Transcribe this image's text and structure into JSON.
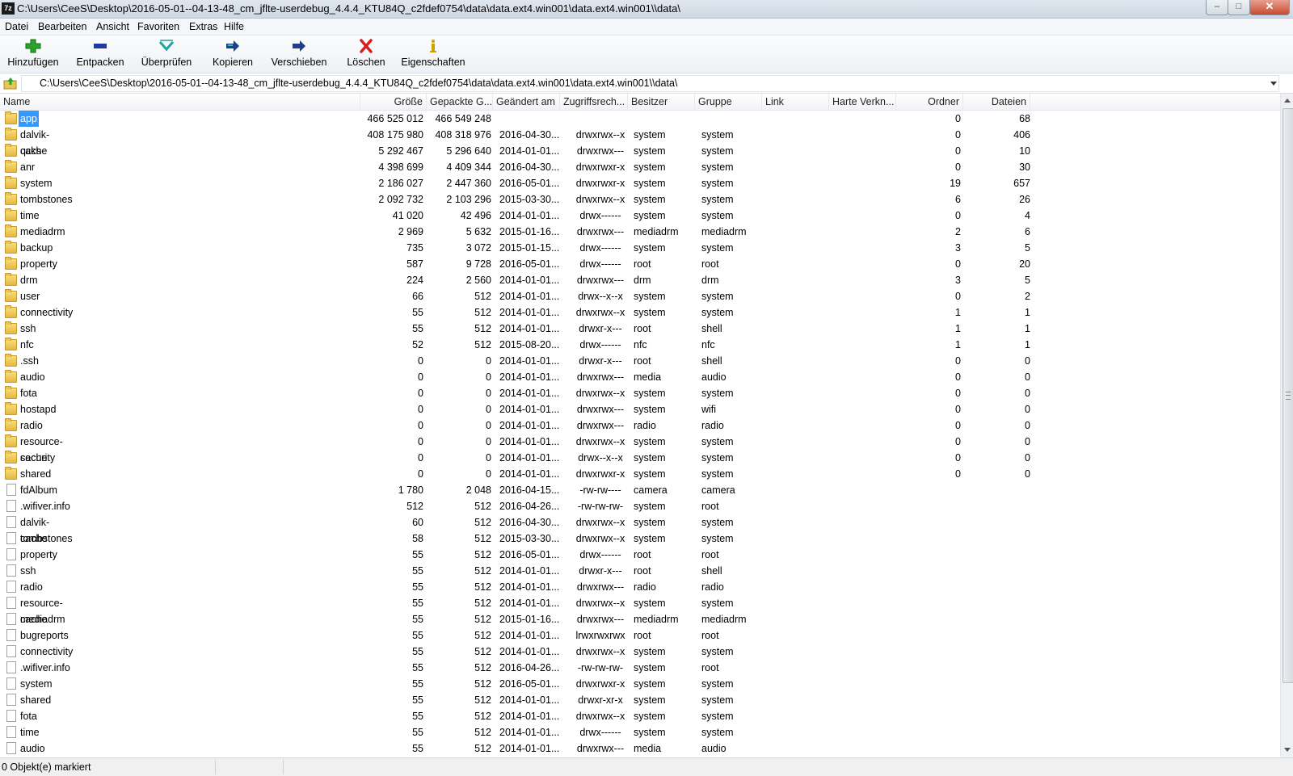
{
  "window": {
    "title": "C:\\Users\\CeeS\\Desktop\\2016-05-01--04-13-48_cm_jflte-userdebug_4.4.4_KTU84Q_c2fdef0754\\data\\data.ext4.win001\\data.ext4.win001\\\\data\\",
    "app_icon_text": "7z",
    "minimize": "–",
    "maximize": "□",
    "close": "✕"
  },
  "menu": [
    "Datei",
    "Bearbeiten",
    "Ansicht",
    "Favoriten",
    "Extras",
    "Hilfe"
  ],
  "toolbar": [
    {
      "label": "Hinzufügen",
      "icon": "add-icon",
      "color": "#2aa32a"
    },
    {
      "label": "Entpacken",
      "icon": "extract-icon",
      "color": "#1e3a9a"
    },
    {
      "label": "Überprüfen",
      "icon": "test-icon",
      "color": "#21a3a0"
    },
    {
      "label": "Kopieren",
      "icon": "copy-icon",
      "color": "#1d3f8a"
    },
    {
      "label": "Verschieben",
      "icon": "move-icon",
      "color": "#1d3f8a"
    },
    {
      "label": "Löschen",
      "icon": "delete-icon",
      "color": "#d42020"
    },
    {
      "label": "Eigenschaften",
      "icon": "info-icon",
      "color": "#c9a400"
    }
  ],
  "address": {
    "path": "C:\\Users\\CeeS\\Desktop\\2016-05-01--04-13-48_cm_jflte-userdebug_4.4.4_KTU84Q_c2fdef0754\\data\\data.ext4.win001\\data.ext4.win001\\\\data\\"
  },
  "columns": [
    "Name",
    "Größe",
    "Gepackte G...",
    "Geändert am",
    "Zugriffsrech...",
    "Besitzer",
    "Gruppe",
    "Link",
    "Harte Verkn...",
    "Ordner",
    "Dateien"
  ],
  "rows": [
    {
      "type": "folder",
      "name": "app",
      "size": "466 525 012",
      "packed": "466 549 248",
      "modified": "",
      "attr": "",
      "owner": "",
      "group": "",
      "folders": "0",
      "files": "68",
      "selected": true
    },
    {
      "type": "folder",
      "name": "dalvik-cache",
      "size": "408 175 980",
      "packed": "408 318 976",
      "modified": "2016-04-30...",
      "attr": "drwxrwx--x",
      "owner": "system",
      "group": "system",
      "folders": "0",
      "files": "406"
    },
    {
      "type": "folder",
      "name": "qcks",
      "size": "5 292 467",
      "packed": "5 296 640",
      "modified": "2014-01-01...",
      "attr": "drwxrwx---",
      "owner": "system",
      "group": "system",
      "folders": "0",
      "files": "10"
    },
    {
      "type": "folder",
      "name": "anr",
      "size": "4 398 699",
      "packed": "4 409 344",
      "modified": "2016-04-30...",
      "attr": "drwxrwxr-x",
      "owner": "system",
      "group": "system",
      "folders": "0",
      "files": "30"
    },
    {
      "type": "folder",
      "name": "system",
      "size": "2 186 027",
      "packed": "2 447 360",
      "modified": "2016-05-01...",
      "attr": "drwxrwxr-x",
      "owner": "system",
      "group": "system",
      "folders": "19",
      "files": "657"
    },
    {
      "type": "folder",
      "name": "tombstones",
      "size": "2 092 732",
      "packed": "2 103 296",
      "modified": "2015-03-30...",
      "attr": "drwxrwx--x",
      "owner": "system",
      "group": "system",
      "folders": "6",
      "files": "26"
    },
    {
      "type": "folder",
      "name": "time",
      "size": "41 020",
      "packed": "42 496",
      "modified": "2014-01-01...",
      "attr": "drwx------",
      "owner": "system",
      "group": "system",
      "folders": "0",
      "files": "4"
    },
    {
      "type": "folder",
      "name": "mediadrm",
      "size": "2 969",
      "packed": "5 632",
      "modified": "2015-01-16...",
      "attr": "drwxrwx---",
      "owner": "mediadrm",
      "group": "mediadrm",
      "folders": "2",
      "files": "6"
    },
    {
      "type": "folder",
      "name": "backup",
      "size": "735",
      "packed": "3 072",
      "modified": "2015-01-15...",
      "attr": "drwx------",
      "owner": "system",
      "group": "system",
      "folders": "3",
      "files": "5"
    },
    {
      "type": "folder",
      "name": "property",
      "size": "587",
      "packed": "9 728",
      "modified": "2016-05-01...",
      "attr": "drwx------",
      "owner": "root",
      "group": "root",
      "folders": "0",
      "files": "20"
    },
    {
      "type": "folder",
      "name": "drm",
      "size": "224",
      "packed": "2 560",
      "modified": "2014-01-01...",
      "attr": "drwxrwx---",
      "owner": "drm",
      "group": "drm",
      "folders": "3",
      "files": "5"
    },
    {
      "type": "folder",
      "name": "user",
      "size": "66",
      "packed": "512",
      "modified": "2014-01-01...",
      "attr": "drwx--x--x",
      "owner": "system",
      "group": "system",
      "folders": "0",
      "files": "2"
    },
    {
      "type": "folder",
      "name": "connectivity",
      "size": "55",
      "packed": "512",
      "modified": "2014-01-01...",
      "attr": "drwxrwx--x",
      "owner": "system",
      "group": "system",
      "folders": "1",
      "files": "1"
    },
    {
      "type": "folder",
      "name": "ssh",
      "size": "55",
      "packed": "512",
      "modified": "2014-01-01...",
      "attr": "drwxr-x---",
      "owner": "root",
      "group": "shell",
      "folders": "1",
      "files": "1"
    },
    {
      "type": "folder",
      "name": "nfc",
      "size": "52",
      "packed": "512",
      "modified": "2015-08-20...",
      "attr": "drwx------",
      "owner": "nfc",
      "group": "nfc",
      "folders": "1",
      "files": "1"
    },
    {
      "type": "folder",
      "name": ".ssh",
      "size": "0",
      "packed": "0",
      "modified": "2014-01-01...",
      "attr": "drwxr-x---",
      "owner": "root",
      "group": "shell",
      "folders": "0",
      "files": "0"
    },
    {
      "type": "folder",
      "name": "audio",
      "size": "0",
      "packed": "0",
      "modified": "2014-01-01...",
      "attr": "drwxrwx---",
      "owner": "media",
      "group": "audio",
      "folders": "0",
      "files": "0"
    },
    {
      "type": "folder",
      "name": "fota",
      "size": "0",
      "packed": "0",
      "modified": "2014-01-01...",
      "attr": "drwxrwx--x",
      "owner": "system",
      "group": "system",
      "folders": "0",
      "files": "0"
    },
    {
      "type": "folder",
      "name": "hostapd",
      "size": "0",
      "packed": "0",
      "modified": "2014-01-01...",
      "attr": "drwxrwx---",
      "owner": "system",
      "group": "wifi",
      "folders": "0",
      "files": "0"
    },
    {
      "type": "folder",
      "name": "radio",
      "size": "0",
      "packed": "0",
      "modified": "2014-01-01...",
      "attr": "drwxrwx---",
      "owner": "radio",
      "group": "radio",
      "folders": "0",
      "files": "0"
    },
    {
      "type": "folder",
      "name": "resource-cache",
      "size": "0",
      "packed": "0",
      "modified": "2014-01-01...",
      "attr": "drwxrwx--x",
      "owner": "system",
      "group": "system",
      "folders": "0",
      "files": "0"
    },
    {
      "type": "folder",
      "name": "security",
      "size": "0",
      "packed": "0",
      "modified": "2014-01-01...",
      "attr": "drwx--x--x",
      "owner": "system",
      "group": "system",
      "folders": "0",
      "files": "0"
    },
    {
      "type": "folder",
      "name": "shared",
      "size": "0",
      "packed": "0",
      "modified": "2014-01-01...",
      "attr": "drwxrwxr-x",
      "owner": "system",
      "group": "system",
      "folders": "0",
      "files": "0"
    },
    {
      "type": "file",
      "name": "fdAlbum",
      "size": "1 780",
      "packed": "2 048",
      "modified": "2016-04-15...",
      "attr": "-rw-rw----",
      "owner": "camera",
      "group": "camera",
      "folders": "",
      "files": ""
    },
    {
      "type": "file",
      "name": ".wifiver.info",
      "size": "512",
      "packed": "512",
      "modified": "2016-04-26...",
      "attr": "-rw-rw-rw-",
      "owner": "system",
      "group": "root",
      "folders": "",
      "files": ""
    },
    {
      "type": "file",
      "name": "dalvik-cache",
      "size": "60",
      "packed": "512",
      "modified": "2016-04-30...",
      "attr": "drwxrwx--x",
      "owner": "system",
      "group": "system",
      "folders": "",
      "files": ""
    },
    {
      "type": "file",
      "name": "tombstones",
      "size": "58",
      "packed": "512",
      "modified": "2015-03-30...",
      "attr": "drwxrwx--x",
      "owner": "system",
      "group": "system",
      "folders": "",
      "files": ""
    },
    {
      "type": "file",
      "name": "property",
      "size": "55",
      "packed": "512",
      "modified": "2016-05-01...",
      "attr": "drwx------",
      "owner": "root",
      "group": "root",
      "folders": "",
      "files": ""
    },
    {
      "type": "file",
      "name": "ssh",
      "size": "55",
      "packed": "512",
      "modified": "2014-01-01...",
      "attr": "drwxr-x---",
      "owner": "root",
      "group": "shell",
      "folders": "",
      "files": ""
    },
    {
      "type": "file",
      "name": "radio",
      "size": "55",
      "packed": "512",
      "modified": "2014-01-01...",
      "attr": "drwxrwx---",
      "owner": "radio",
      "group": "radio",
      "folders": "",
      "files": ""
    },
    {
      "type": "file",
      "name": "resource-cache",
      "size": "55",
      "packed": "512",
      "modified": "2014-01-01...",
      "attr": "drwxrwx--x",
      "owner": "system",
      "group": "system",
      "folders": "",
      "files": ""
    },
    {
      "type": "file",
      "name": "mediadrm",
      "size": "55",
      "packed": "512",
      "modified": "2015-01-16...",
      "attr": "drwxrwx---",
      "owner": "mediadrm",
      "group": "mediadrm",
      "folders": "",
      "files": ""
    },
    {
      "type": "file",
      "name": "bugreports",
      "size": "55",
      "packed": "512",
      "modified": "2014-01-01...",
      "attr": "lrwxrwxrwx",
      "owner": "root",
      "group": "root",
      "folders": "",
      "files": ""
    },
    {
      "type": "file",
      "name": "connectivity",
      "size": "55",
      "packed": "512",
      "modified": "2014-01-01...",
      "attr": "drwxrwx--x",
      "owner": "system",
      "group": "system",
      "folders": "",
      "files": ""
    },
    {
      "type": "file",
      "name": ".wifiver.info",
      "size": "55",
      "packed": "512",
      "modified": "2016-04-26...",
      "attr": "-rw-rw-rw-",
      "owner": "system",
      "group": "root",
      "folders": "",
      "files": ""
    },
    {
      "type": "file",
      "name": "system",
      "size": "55",
      "packed": "512",
      "modified": "2016-05-01...",
      "attr": "drwxrwxr-x",
      "owner": "system",
      "group": "system",
      "folders": "",
      "files": ""
    },
    {
      "type": "file",
      "name": "shared",
      "size": "55",
      "packed": "512",
      "modified": "2014-01-01...",
      "attr": "drwxr-xr-x",
      "owner": "system",
      "group": "system",
      "folders": "",
      "files": ""
    },
    {
      "type": "file",
      "name": "fota",
      "size": "55",
      "packed": "512",
      "modified": "2014-01-01...",
      "attr": "drwxrwx--x",
      "owner": "system",
      "group": "system",
      "folders": "",
      "files": ""
    },
    {
      "type": "file",
      "name": "time",
      "size": "55",
      "packed": "512",
      "modified": "2014-01-01...",
      "attr": "drwx------",
      "owner": "system",
      "group": "system",
      "folders": "",
      "files": ""
    },
    {
      "type": "file",
      "name": "audio",
      "size": "55",
      "packed": "512",
      "modified": "2014-01-01...",
      "attr": "drwxrwx---",
      "owner": "media",
      "group": "audio",
      "folders": "",
      "files": ""
    }
  ],
  "status": {
    "selection": "0 Objekt(e) markiert"
  }
}
